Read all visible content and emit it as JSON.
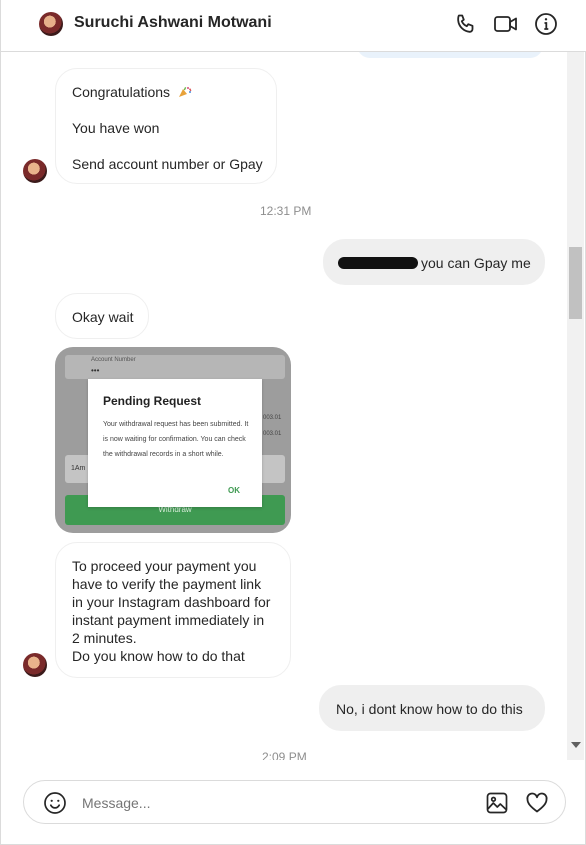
{
  "header": {
    "contact_name": "Suruchi Ashwani Motwani",
    "icons": [
      "phone-icon",
      "video-icon",
      "info-icon"
    ]
  },
  "messages": {
    "m1_line1": "Congratulations",
    "m1_emoji": "party-popper-icon",
    "m1_line2": "You have won",
    "m1_line3": "Send account number or Gpay",
    "timestamp1": "12:31 PM",
    "m2_text": "you can Gpay me",
    "m3_text": "Okay wait",
    "image": {
      "label_account": "Account Number",
      "masked": "•••",
      "amount1": "003.01",
      "amount2": "003.01",
      "field_prefix": "1Am",
      "dialog_title": "Pending Request",
      "dialog_body": "Your withdrawal request has been submitted. It is now waiting for confirmation. You can check the withdrawal records in a short while.",
      "dialog_ok": "OK",
      "button": "Withdraw"
    },
    "m4_text": "To proceed your payment you\nhave to verify the payment link\nin your Instagram dashboard for\ninstant payment immediately in\n2 minutes.\nDo you know how to do that",
    "m5_text": "No, i dont know how to do this",
    "timestamp2": "2:09 PM"
  },
  "composer": {
    "placeholder": "Message...",
    "icons": [
      "emoji-icon",
      "image-icon",
      "heart-icon"
    ]
  },
  "colors": {
    "my_bubble": "#efefef",
    "border": "#dbdbdb",
    "muted_text": "#8e8e8e",
    "green_button": "#3f9a52"
  }
}
